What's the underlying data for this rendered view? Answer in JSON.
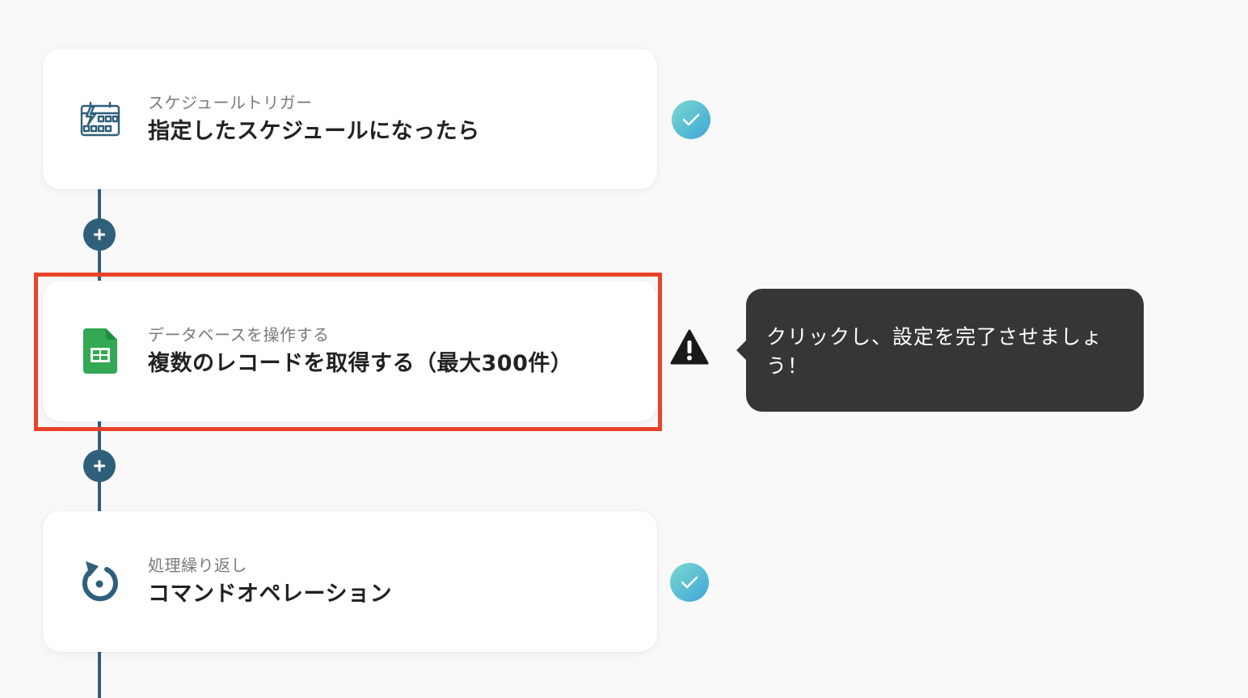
{
  "flow": {
    "steps": [
      {
        "subtitle": "スケジュールトリガー",
        "title": "指定したスケジュールになったら",
        "icon": "schedule-calendar-icon",
        "status": "complete"
      },
      {
        "subtitle": "データベースを操作する",
        "title": "複数のレコードを取得する（最大300件）",
        "icon": "google-sheets-icon",
        "status": "warning"
      },
      {
        "subtitle": "処理繰り返し",
        "title": "コマンドオペレーション",
        "icon": "loop-arrow-icon",
        "status": "complete"
      }
    ],
    "add_buttons": [
      "plus-icon",
      "plus-icon"
    ]
  },
  "tooltip": {
    "text": "クリックし、設定を完了させましょう！"
  },
  "colors": {
    "connector": "#2f5f7a",
    "highlight": "#e84328",
    "tooltip_bg": "#363636",
    "sheets_green": "#34a853",
    "status_gradient": [
      "#7bd8d0",
      "#3ea6d8"
    ]
  }
}
